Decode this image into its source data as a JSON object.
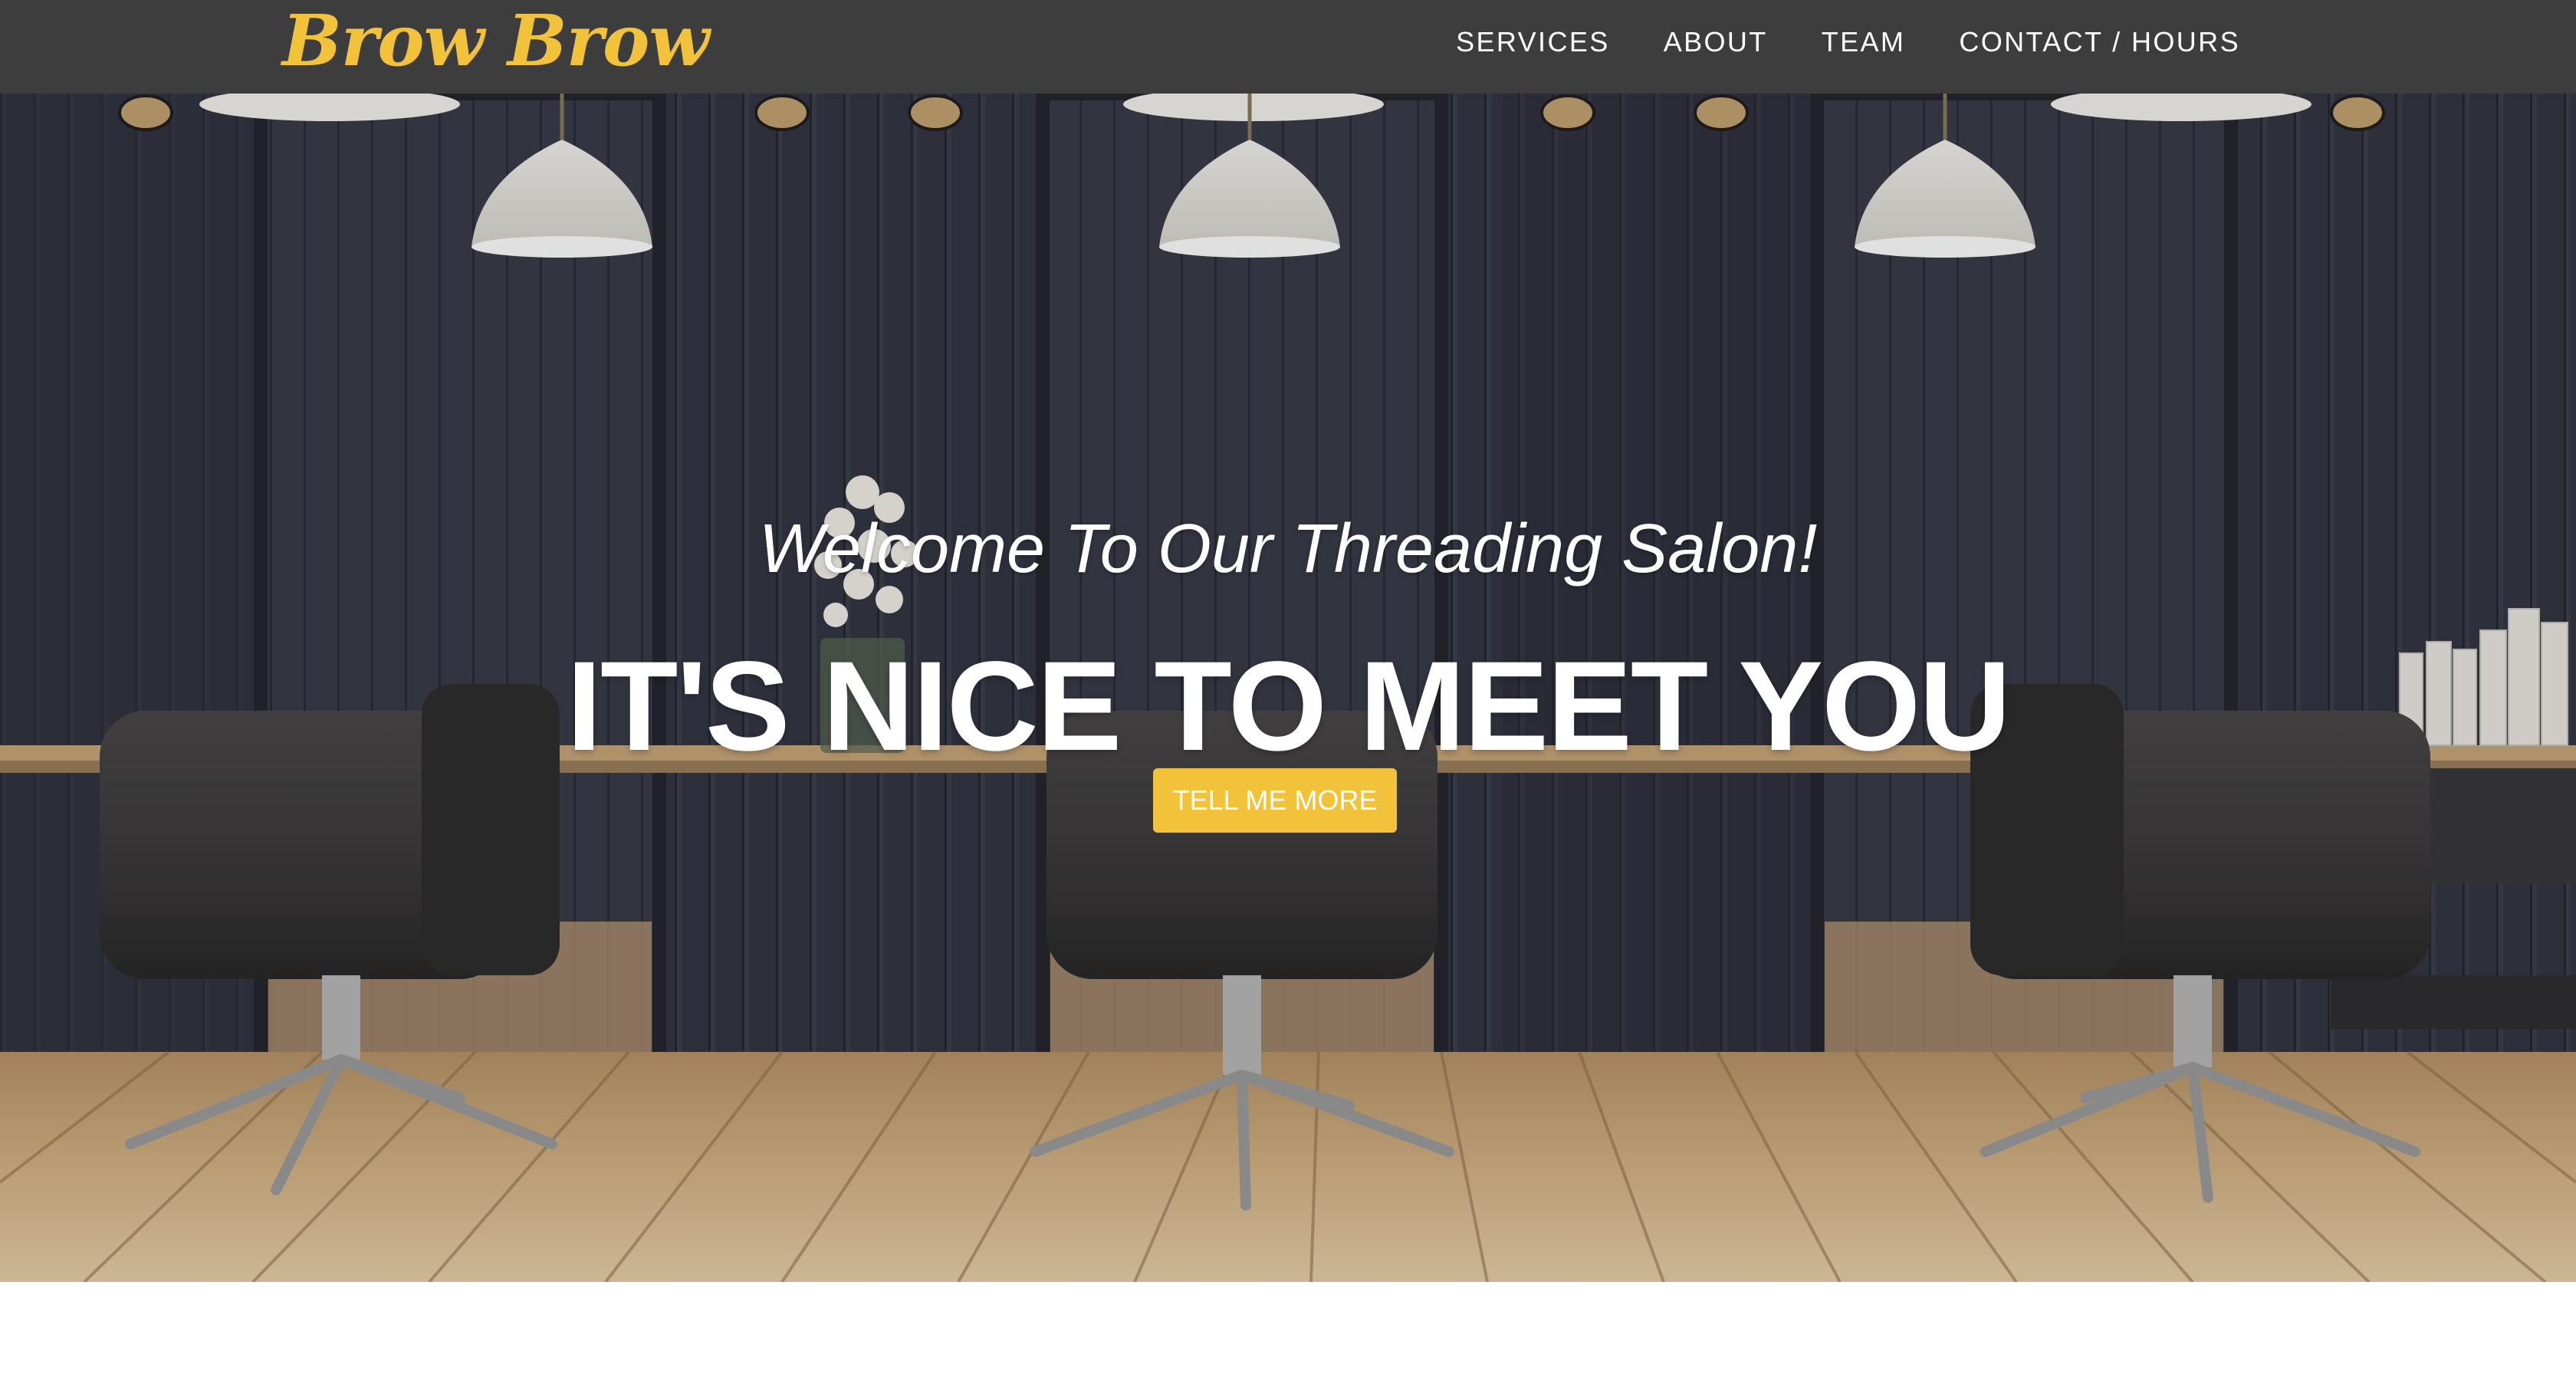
{
  "brand": {
    "name": "Brow Brow",
    "color": "#f2c23a"
  },
  "nav": {
    "items": [
      {
        "label": "SERVICES"
      },
      {
        "label": "ABOUT"
      },
      {
        "label": "TEAM"
      },
      {
        "label": "CONTACT / HOURS"
      }
    ],
    "background": "#3d3d3d"
  },
  "hero": {
    "subtitle": "Welcome To Our Threading Salon!",
    "heading": "IT'S NICE TO MEET YOU",
    "cta_label": "TELL ME MORE",
    "cta_color": "#f2c23a",
    "background_image": "salon-interior-photo"
  }
}
